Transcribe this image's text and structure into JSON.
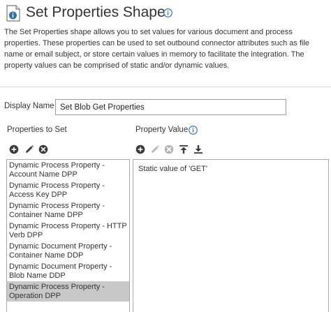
{
  "header": {
    "title": "Set Properties Shape",
    "shape_icon": "set-properties-shape-icon",
    "info_icon": "info-icon"
  },
  "description": "The Set Properties shape allows you to set values for various document and process properties. These properties can be used to set outbound connector attributes such as file name or email subject, or store certain values in memory to facilitate the integration. The property values can be comprised of static and/or dynamic values.",
  "display_name": {
    "label": "Display Name",
    "value": "Set Blob Get Properties"
  },
  "properties": {
    "label": "Properties to Set",
    "toolbar": {
      "add_icon": "add-circle-icon",
      "edit_icon": "pencil-icon",
      "delete_icon": "delete-circle-icon"
    },
    "items": [
      {
        "label": "Dynamic Process Property - Account Name DPP",
        "selected": false
      },
      {
        "label": "Dynamic Process Property - Access Key DPP",
        "selected": false
      },
      {
        "label": "Dynamic Process Property - Container Name DPP",
        "selected": false
      },
      {
        "label": "Dynamic Process Property - HTTP Verb DPP",
        "selected": false
      },
      {
        "label": "Dynamic Document Property - Container Name DDP",
        "selected": false
      },
      {
        "label": "Dynamic Document Property - Blob Name DDP",
        "selected": false
      },
      {
        "label": "Dynamic Process Property - Operation DPP",
        "selected": true
      }
    ]
  },
  "property_value": {
    "label": "Property Value",
    "info_icon": "info-icon",
    "toolbar": {
      "add_icon": "add-circle-icon",
      "edit_icon": "pencil-icon",
      "delete_icon": "delete-circle-icon",
      "move_top_icon": "move-to-top-icon",
      "move_bottom_icon": "move-to-bottom-icon"
    },
    "values": [
      "Static value of 'GET'"
    ]
  },
  "colors": {
    "icon_dark": "#3a3a3a",
    "icon_disabled": "#b5b5b5",
    "info_blue": "#2f6db5",
    "selected_row": "#c8c8c8"
  }
}
